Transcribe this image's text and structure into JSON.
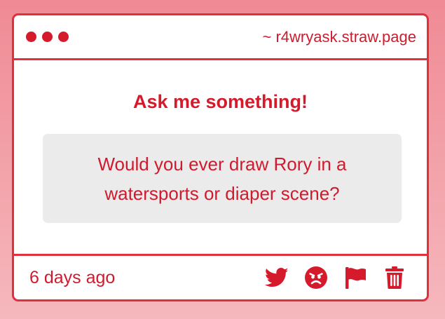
{
  "window": {
    "url": "~ r4wryask.straw.page"
  },
  "main": {
    "heading": "Ask me something!",
    "question": "Would you ever draw Rory in a watersports or diaper scene?"
  },
  "footer": {
    "timestamp": "6 days ago",
    "actions": [
      {
        "icon": "twitter-icon"
      },
      {
        "icon": "angry-face-icon"
      },
      {
        "icon": "flag-icon"
      },
      {
        "icon": "trash-icon"
      }
    ]
  },
  "colors": {
    "accent": "#d51a2c",
    "border": "#e0303c",
    "question_bg": "#ecebec"
  }
}
